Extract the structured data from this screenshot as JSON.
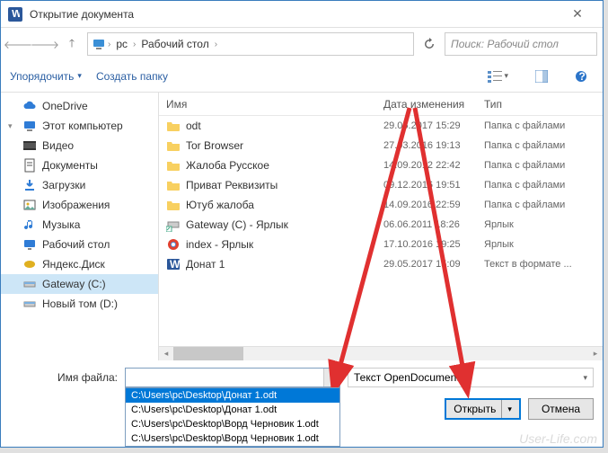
{
  "title": "Открытие документа",
  "breadcrumb": {
    "root": "pc",
    "folder": "Рабочий стол"
  },
  "search_placeholder": "Поиск: Рабочий стол",
  "toolbar": {
    "organize": "Упорядочить",
    "new_folder": "Создать папку"
  },
  "sidebar": {
    "items": [
      {
        "label": "OneDrive",
        "icon": "cloud",
        "color": "#2f7cd6"
      },
      {
        "label": "Этот компьютер",
        "icon": "pc",
        "color": "#2f7cd6",
        "tree": "▾"
      },
      {
        "label": "Видео",
        "icon": "video",
        "color": "#555"
      },
      {
        "label": "Документы",
        "icon": "doc",
        "color": "#555"
      },
      {
        "label": "Загрузки",
        "icon": "download",
        "color": "#2f7cd6"
      },
      {
        "label": "Изображения",
        "icon": "image",
        "color": "#555"
      },
      {
        "label": "Музыка",
        "icon": "music",
        "color": "#2f7cd6"
      },
      {
        "label": "Рабочий стол",
        "icon": "desktop",
        "color": "#2f7cd6"
      },
      {
        "label": "Яндекс.Диск",
        "icon": "ydisk",
        "color": "#e0b020"
      },
      {
        "label": "Gateway (C:)",
        "icon": "drive",
        "color": "#888",
        "selected": true
      },
      {
        "label": "Новый том (D:)",
        "icon": "drive",
        "color": "#888"
      }
    ]
  },
  "columns": {
    "name": "Имя",
    "date": "Дата изменения",
    "type": "Тип"
  },
  "files": [
    {
      "name": "odt",
      "date": "29.05.2017 15:29",
      "type": "Папка с файлами",
      "icon": "folder"
    },
    {
      "name": "Tor Browser",
      "date": "27.03.2016 19:13",
      "type": "Папка с файлами",
      "icon": "folder"
    },
    {
      "name": "Жалоба Русское",
      "date": "14.09.2012 22:42",
      "type": "Папка с файлами",
      "icon": "folder"
    },
    {
      "name": "Приват Реквизиты",
      "date": "09.12.2016 19:51",
      "type": "Папка с файлами",
      "icon": "folder"
    },
    {
      "name": "Ютуб жалоба",
      "date": "14.09.2016 22:59",
      "type": "Папка с файлами",
      "icon": "folder"
    },
    {
      "name": "Gateway (C) - Ярлык",
      "date": "06.06.2011 18:26",
      "type": "Ярлык",
      "icon": "drive-lnk"
    },
    {
      "name": "index - Ярлык",
      "date": "17.10.2016 19:25",
      "type": "Ярлык",
      "icon": "chrome-lnk"
    },
    {
      "name": "Донат 1",
      "date": "29.05.2017 15:09",
      "type": "Текст в формате ...",
      "icon": "word"
    }
  ],
  "filename_label": "Имя файла:",
  "filetype_value": "Текст OpenDocument",
  "dropdown": {
    "items": [
      "C:\\Users\\pc\\Desktop\\Донат 1.odt",
      "C:\\Users\\pc\\Desktop\\Донат 1.odt",
      "C:\\Users\\pc\\Desktop\\Ворд Черновик 1.odt",
      "C:\\Users\\pc\\Desktop\\Ворд Черновик 1.odt"
    ]
  },
  "buttons": {
    "open": "Открыть",
    "cancel": "Отмена"
  },
  "watermark": "User-Life.com"
}
